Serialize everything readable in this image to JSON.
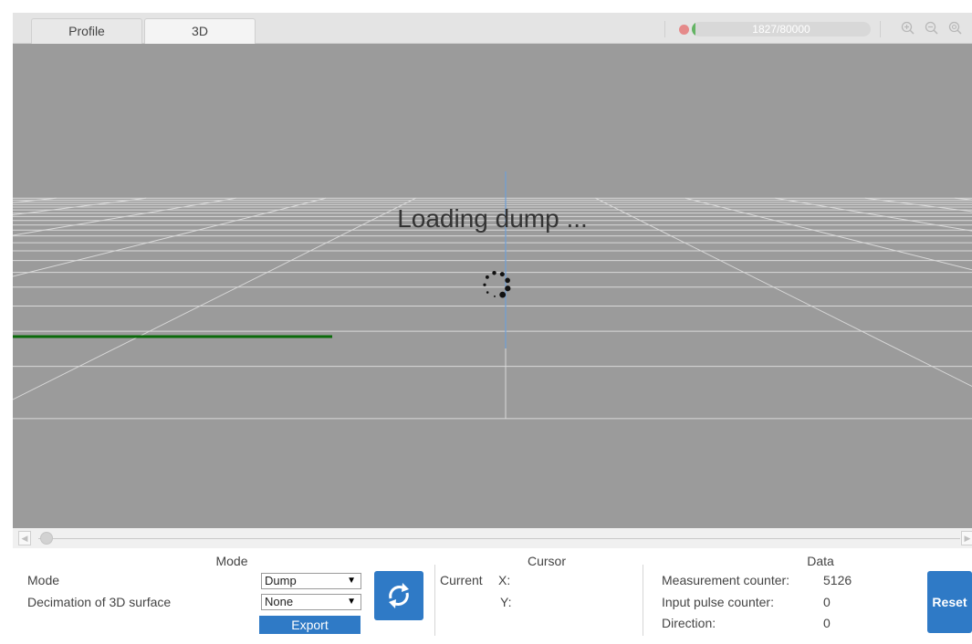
{
  "tabs": [
    {
      "label": "Profile",
      "active": false
    },
    {
      "label": "3D",
      "active": true
    }
  ],
  "progress": {
    "text": "1827/80000",
    "current": 1827,
    "total": 80000
  },
  "toolbar": {
    "icons": [
      "zoom-in-icon",
      "zoom-out-icon",
      "zoom-reset-icon"
    ]
  },
  "viewport": {
    "loading_text": "Loading dump ..."
  },
  "mode_group": {
    "title": "Mode",
    "mode_label": "Mode",
    "mode_value": "Dump",
    "decimation_label": "Decimation of 3D surface",
    "decimation_value": "None",
    "export_label": "Export"
  },
  "cursor_group": {
    "title": "Cursor",
    "current_label": "Current",
    "x_label": "X:",
    "y_label": "Y:"
  },
  "data_group": {
    "title": "Data",
    "rows": [
      {
        "label": "Measurement counter:",
        "value": "5126"
      },
      {
        "label": "Input pulse counter:",
        "value": "0"
      },
      {
        "label": "Direction:",
        "value": "0"
      }
    ],
    "reset_label": "Reset"
  },
  "colors": {
    "accent": "#2f7ac6",
    "viewport_bg": "#9b9b9b",
    "grid": "#d9d9d9",
    "green_axis": "#0a6a0a",
    "blue_axis": "#6f9fd6",
    "status_dot": "#e58a8a"
  }
}
